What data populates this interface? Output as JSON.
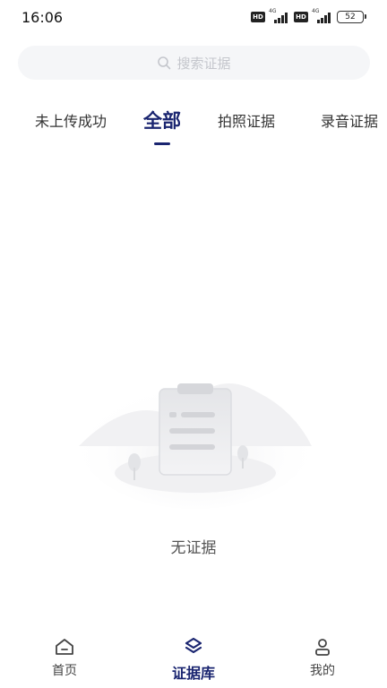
{
  "status": {
    "time": "16:06",
    "sim1_badge": "HD",
    "sim1_network": "4G",
    "sim2_badge": "HD",
    "sim2_network": "4G",
    "battery": "52"
  },
  "search": {
    "icon": "search-icon",
    "placeholder": "搜索证据"
  },
  "tabs": [
    {
      "label": "未上传成功"
    },
    {
      "label": "全部",
      "active": true
    },
    {
      "label": "拍照证据"
    },
    {
      "label": "录音证据"
    }
  ],
  "empty_state": {
    "icon": "clipboard-illustration",
    "message": "无证据"
  },
  "bottom_nav": [
    {
      "label": "首页",
      "icon": "home-icon"
    },
    {
      "label": "证据库",
      "icon": "layers-icon",
      "active": true
    },
    {
      "label": "我的",
      "icon": "user-icon"
    }
  ],
  "colors": {
    "accent": "#1a2570",
    "search_bg": "#f5f6f8",
    "placeholder": "#c4c6cc",
    "text": "#333333"
  }
}
